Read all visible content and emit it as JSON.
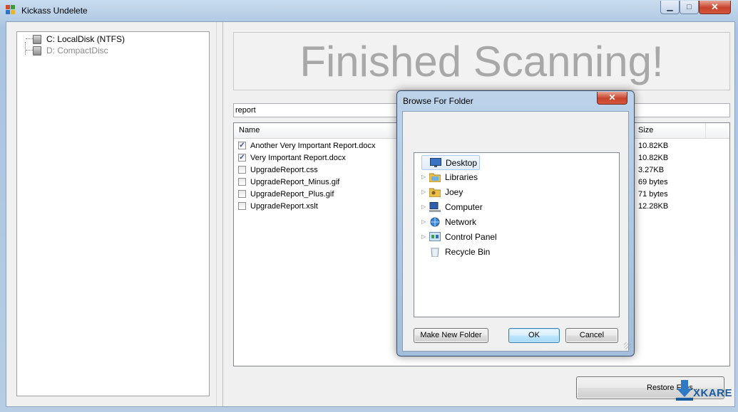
{
  "window": {
    "title": "Kickass Undelete",
    "minimize_glyph": "▁",
    "maximize_glyph": "□",
    "close_glyph": "✕"
  },
  "drives": [
    {
      "label": "C: LocalDisk (NTFS)",
      "active": true
    },
    {
      "label": "D: CompactDisc",
      "active": false
    }
  ],
  "banner": {
    "text": "Finished Scanning!"
  },
  "search": {
    "value": "report"
  },
  "file_list": {
    "columns": {
      "name": "Name",
      "size": "Size"
    },
    "rows": [
      {
        "name": "Another Very Important Report.docx",
        "size": "10.82KB",
        "checked": true
      },
      {
        "name": "Very Important Report.docx",
        "size": "10.82KB",
        "checked": true
      },
      {
        "name": "UpgradeReport.css",
        "size": "3.27KB",
        "checked": false
      },
      {
        "name": "UpgradeReport_Minus.gif",
        "size": "69 bytes",
        "checked": false
      },
      {
        "name": "UpgradeReport_Plus.gif",
        "size": "71 bytes",
        "checked": false
      },
      {
        "name": "UpgradeReport.xslt",
        "size": "12.28KB",
        "checked": false
      }
    ]
  },
  "restore_button": {
    "label": "Restore Files..."
  },
  "watermark": {
    "text": "XKARE"
  },
  "dialog": {
    "title": "Browse For Folder",
    "close_glyph": "✕",
    "folders": [
      {
        "label": "Desktop",
        "icon": "desktop-icon",
        "expandable": false,
        "selected": true
      },
      {
        "label": "Libraries",
        "icon": "libraries-icon",
        "expandable": true,
        "selected": false
      },
      {
        "label": "Joey",
        "icon": "user-folder-icon",
        "expandable": true,
        "selected": false
      },
      {
        "label": "Computer",
        "icon": "computer-icon",
        "expandable": true,
        "selected": false
      },
      {
        "label": "Network",
        "icon": "network-icon",
        "expandable": true,
        "selected": false
      },
      {
        "label": "Control Panel",
        "icon": "control-panel-icon",
        "expandable": true,
        "selected": false
      },
      {
        "label": "Recycle Bin",
        "icon": "recycle-bin-icon",
        "expandable": false,
        "selected": false
      }
    ],
    "buttons": {
      "new_folder": "Make New Folder",
      "ok": "OK",
      "cancel": "Cancel"
    }
  },
  "colors": {
    "accent": "#3c7fb1",
    "banner_text": "#a8a8a8",
    "close_red": "#c7432c"
  }
}
